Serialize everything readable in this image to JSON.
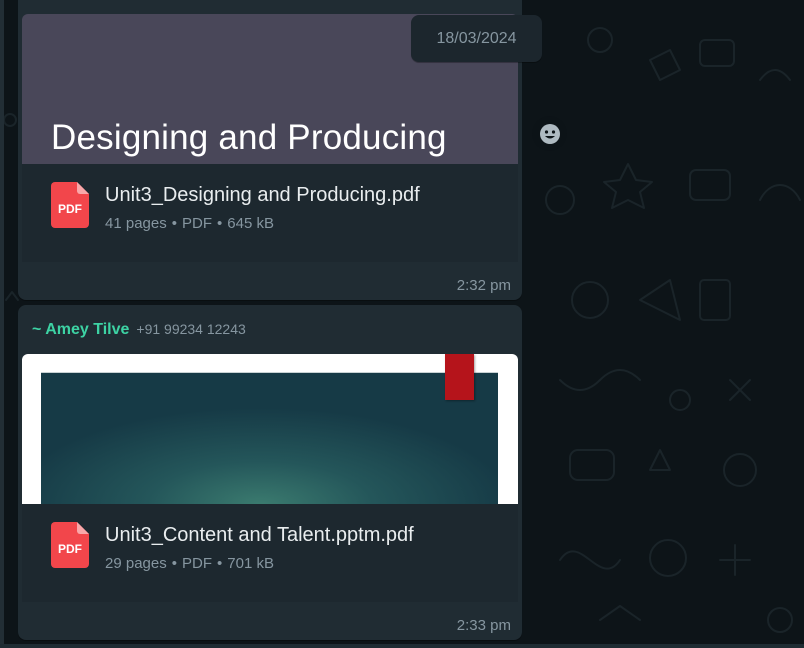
{
  "date_chip": "18/03/2024",
  "messages": [
    {
      "preview_title": "Designing and Producing",
      "file": {
        "icon": "pdf-icon",
        "icon_label": "PDF",
        "name": "Unit3_Designing and Producing.pdf",
        "pages": "41 pages",
        "type": "PDF",
        "size": "645 kB"
      },
      "time": "2:32 pm"
    },
    {
      "sender": {
        "name": "~ Amey Tilve",
        "phone": "+91 99234 12243",
        "color": "#3dd3a4"
      },
      "file": {
        "icon": "pdf-icon",
        "icon_label": "PDF",
        "name": "Unit3_Content and Talent.pptm.pdf",
        "pages": "29 pages",
        "type": "PDF",
        "size": "701 kB"
      },
      "time": "2:33 pm"
    }
  ],
  "meta_separator": "•",
  "reaction_button": {
    "icon": "emoji-icon"
  },
  "colors": {
    "bubble": "#202c33",
    "file_card": "#1d282f",
    "pdf_red": "#f2464b",
    "secondary_text": "#8696a0"
  }
}
